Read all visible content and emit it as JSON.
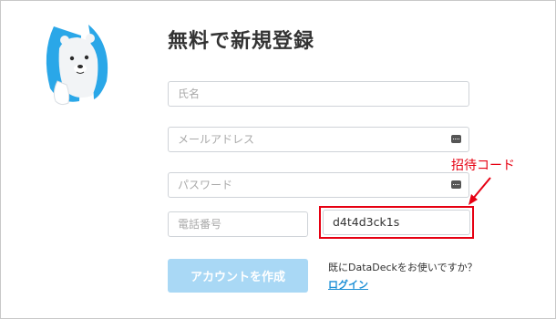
{
  "page": {
    "title": "無料で新規登録"
  },
  "form": {
    "name_placeholder": "氏名",
    "email_placeholder": "メールアドレス",
    "password_placeholder": "パスワード",
    "phone_placeholder": "電話番号",
    "invite_code_value": "d4t4d3ck1s"
  },
  "annotation": {
    "invite_code_label": "招待コード",
    "color": "#e60012"
  },
  "actions": {
    "create_account_label": "アカウントを作成",
    "login_prompt": "既にDataDeckをお使いですか？",
    "login_link": "ログイン"
  },
  "colors": {
    "button_bg": "#a9d8f5",
    "link": "#1e90d6",
    "mascot_accent": "#2aa7e8"
  },
  "icons": {
    "mascot": "polar-bear-icon",
    "password_manager": "password-keyboard-icon"
  }
}
